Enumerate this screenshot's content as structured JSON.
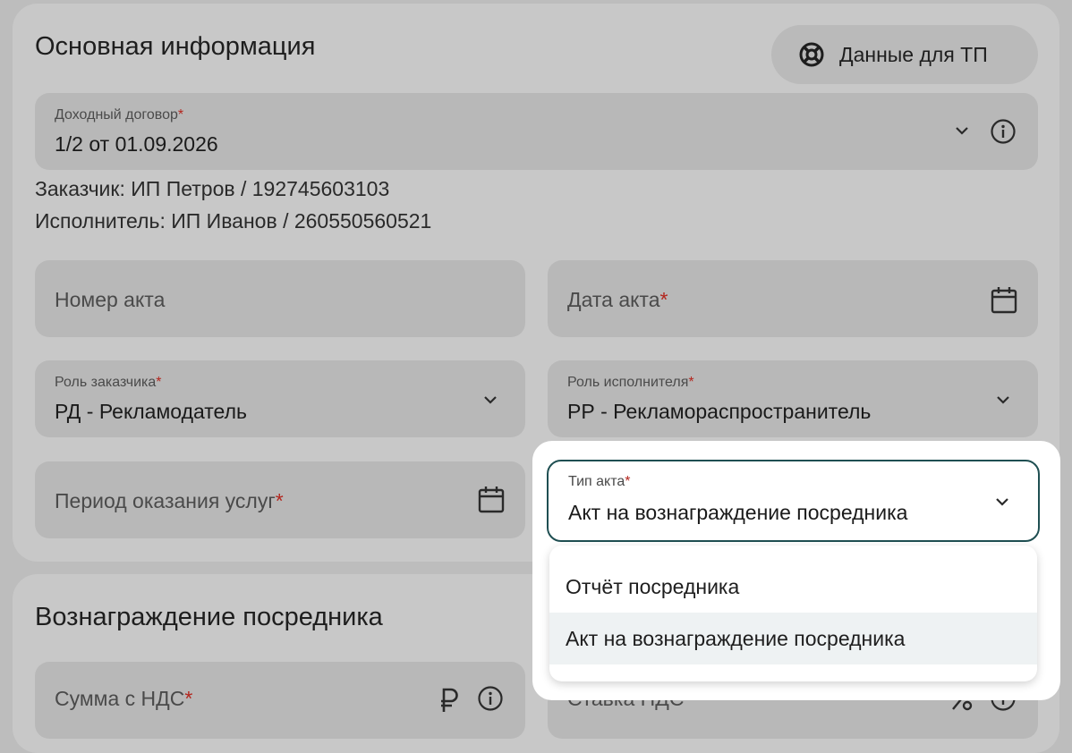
{
  "section1": {
    "title": "Основная информация",
    "support_button_label": "Данные для ТП",
    "contract": {
      "label": "Доходный договор",
      "value": "1/2 от 01.09.2026"
    },
    "customer_line": "Заказчик: ИП Петров / 192745603103",
    "executor_line": "Исполнитель: ИП Иванов / 260550560521",
    "act_number": {
      "placeholder": "Номер акта"
    },
    "act_date": {
      "placeholder": "Дата акта"
    },
    "customer_role": {
      "label": "Роль заказчика",
      "value": "РД - Рекламодатель"
    },
    "executor_role": {
      "label": "Роль исполнителя",
      "value": "РР - Рекламораспространитель"
    },
    "service_period": {
      "placeholder": "Период оказания услуг"
    },
    "act_type": {
      "label": "Тип акта",
      "value": "Акт на вознаграждение посредника",
      "options": [
        "Отчёт посредника",
        "Акт на вознаграждение посредника"
      ]
    },
    "required_mark": "*"
  },
  "section2": {
    "title": "Вознаграждение посредника",
    "amount_field": {
      "placeholder": "Сумма с НДС"
    },
    "vat_rate_field": {
      "placeholder": "Ставка НДС"
    }
  },
  "colors": {
    "accent": "#1f4f52",
    "required": "#b3261e"
  }
}
